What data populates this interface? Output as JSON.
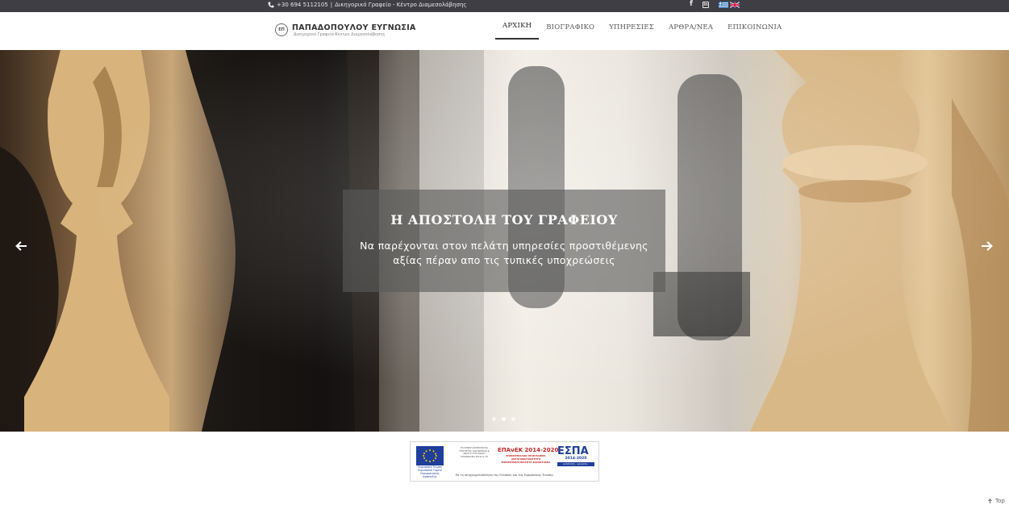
{
  "topbar": {
    "phone": "+30 694 5112105",
    "separator": "|",
    "tagline": "Δικηγορικό Γραφείο - Κέντρο Διαμεσολάβησης",
    "social": [
      "facebook-icon",
      "linkedin-icon"
    ],
    "languages": [
      "greek-flag-icon",
      "uk-flag-icon"
    ]
  },
  "header": {
    "brand_name": "ΠΑΠΑΔΟΠΟΥΛΟΥ ΕΥΓΝΩΣΙΑ",
    "brand_subtitle": "Δικηγορικό Γραφείο-Κέντρο Διαμεσολάβησης",
    "nav": [
      {
        "label": "ΑΡΧΙΚΗ",
        "active": true
      },
      {
        "label": "ΒΙΟΓΡΑΦΙΚΟ",
        "active": false
      },
      {
        "label": "ΥΠΗΡΕΣΙΕΣ",
        "active": false
      },
      {
        "label": "ΑΡΘΡΑ/ΝΕΑ",
        "active": false
      },
      {
        "label": "ΕΠΙΚΟΙΝΩΝΙΑ",
        "active": false
      }
    ]
  },
  "hero": {
    "caption_title": "Η ΑΠΟΣΤΟΛΗ ΤΟΥ ΓΡΑΦΕΙΟΥ",
    "caption_text": "Να παρέχονται στον πελάτη υπηρεσίες προστιθέμενης αξίας πέραν απο τις τυπικές υποχρεώσεις",
    "slides_count": 3,
    "active_slide": 2,
    "prev_icon": "arrow-left-icon",
    "next_icon": "arrow-right-icon"
  },
  "espa_banner": {
    "eu_label": "Ευρωπαϊκή Ένωση Ευρωπαϊκό Ταμείο Περιφερειακής Ανάπτυξης",
    "ministry": "ΕΛΛΗΝΙΚΗ ΔΗΜΟΚΡΑΤΙΑ ΥΠΟΥΡΓΕΙΟ ΟΙΚΟΝΟΜΙΑΣ & ΑΝΑΠΤΥΞΗΣ ΕΙΔΙΚΗ ΓΡΑΜΜΑΤΕΙΑ ΕΤΠΑ & ΤΣ",
    "epanek": "ΕΠΑνΕΚ 2014-2020",
    "epanek_sub": "ΕΠΙΧΕΙΡΗΣΙΑΚΟ ΠΡΟΓΡΑΜΜΑ ΑΝΤΑΓΩΝΙΣΤΙΚΟΤΗΤΑ ΕΠΙΧΕΙΡΗΜΑΤΙΚΟΤΗΤΑ ΚΑΙΝΟΤΟΜΙΑ",
    "espa": "ΕΣΠΑ",
    "espa_years": "2014-2020",
    "espa_bar": "ανάπτυξη - εργασία - αλληλεγγύη",
    "note": "Με τη συγχρηματοδότηση της Ελλάδας και της Ευρωπαϊκής Ένωσης"
  },
  "footer": {
    "to_top": "Top"
  },
  "colors": {
    "topbar": "#3e3e44",
    "caption_bg": "rgba(90,90,90,0.62)",
    "eu_blue": "#1f3f9a",
    "epanek_red": "#c62828"
  }
}
